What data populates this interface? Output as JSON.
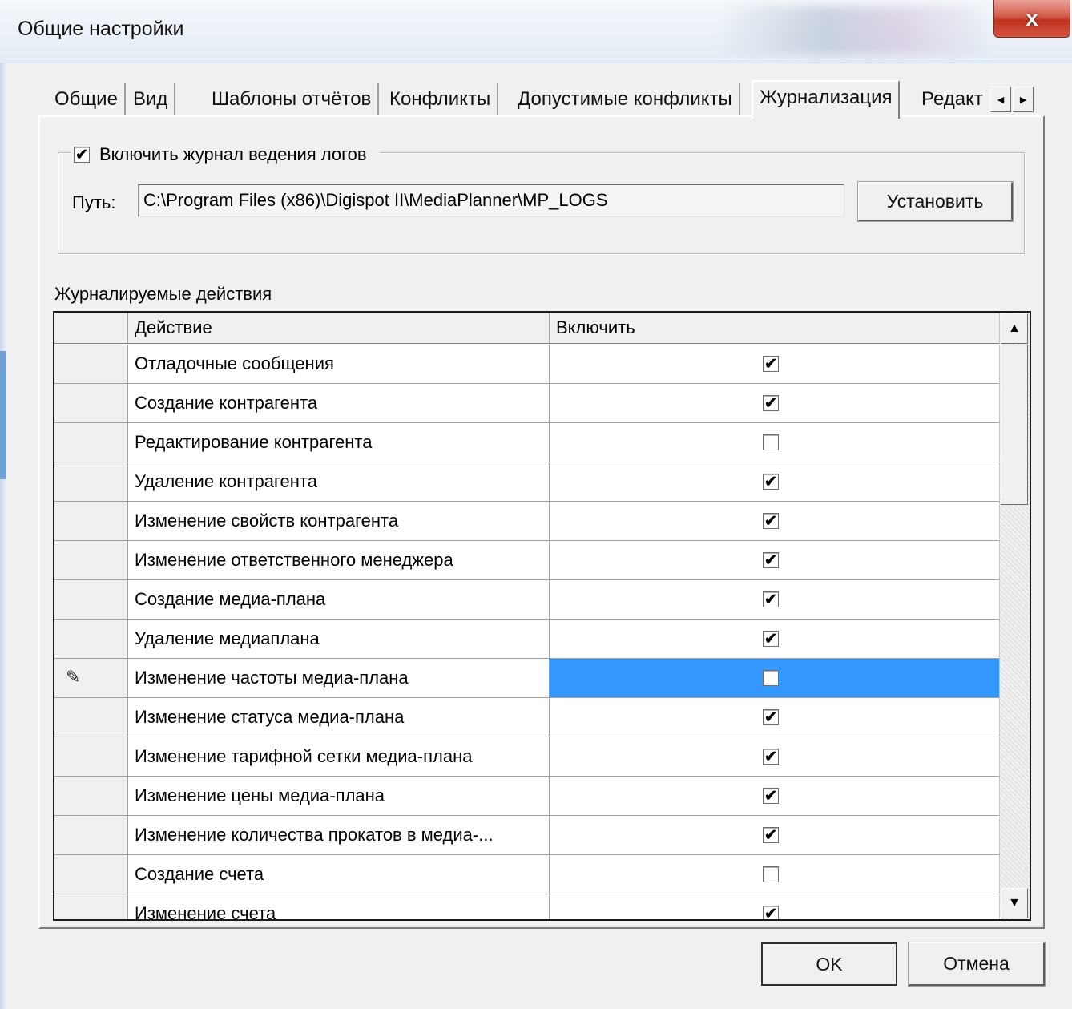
{
  "window": {
    "title": "Общие настройки",
    "close_glyph": "x"
  },
  "tabs": [
    {
      "label": "Общие",
      "active": false
    },
    {
      "label": "Вид",
      "active": false
    },
    {
      "label": "Шаблоны отчётов",
      "active": false
    },
    {
      "label": "Конфликты",
      "active": false
    },
    {
      "label": "Допустимые конфликты",
      "active": false
    },
    {
      "label": "Журнализация",
      "active": true
    },
    {
      "label": "Редакт",
      "active": false
    }
  ],
  "tab_scroll": {
    "left": "◄",
    "right": "►"
  },
  "logging": {
    "enable_label": "Включить журнал ведения логов",
    "enabled": true,
    "path_label": "Путь:",
    "path_value": "C:\\Program Files (x86)\\Digispot II\\MediaPlanner\\MP_LOGS",
    "set_button": "Установить"
  },
  "actions_section": {
    "label": "Журналируемые действия",
    "columns": [
      "",
      "Действие",
      "Включить"
    ],
    "rows": [
      {
        "action": "Отладочные сообщения",
        "enabled": true
      },
      {
        "action": "Создание контрагента",
        "enabled": true
      },
      {
        "action": "Редактирование контрагента",
        "enabled": false
      },
      {
        "action": "Удаление контрагента",
        "enabled": true
      },
      {
        "action": "Изменение свойств контрагента",
        "enabled": true
      },
      {
        "action": "Изменение ответственного менеджера",
        "enabled": true
      },
      {
        "action": "Создание медиа-плана",
        "enabled": true
      },
      {
        "action": "Удаление медиаплана",
        "enabled": true
      },
      {
        "action": "Изменение частоты медиа-плана",
        "enabled": false,
        "selected": true,
        "editing": true
      },
      {
        "action": "Изменение статуса медиа-плана",
        "enabled": true
      },
      {
        "action": "Изменение тарифной сетки медиа-плана",
        "enabled": true
      },
      {
        "action": "Изменение цены медиа-плана",
        "enabled": true
      },
      {
        "action": "Изменение количества прокатов в медиа-...",
        "enabled": true
      },
      {
        "action": "Создание счета",
        "enabled": false
      },
      {
        "action": "Изменение счета",
        "enabled": true
      }
    ],
    "scroll_up": "▲",
    "scroll_down": "▼",
    "edit_indicator": "✎"
  },
  "buttons": {
    "ok": "OK",
    "cancel": "Отмена"
  },
  "colors": {
    "selection": "#3399ff",
    "close": "#c0321f"
  }
}
